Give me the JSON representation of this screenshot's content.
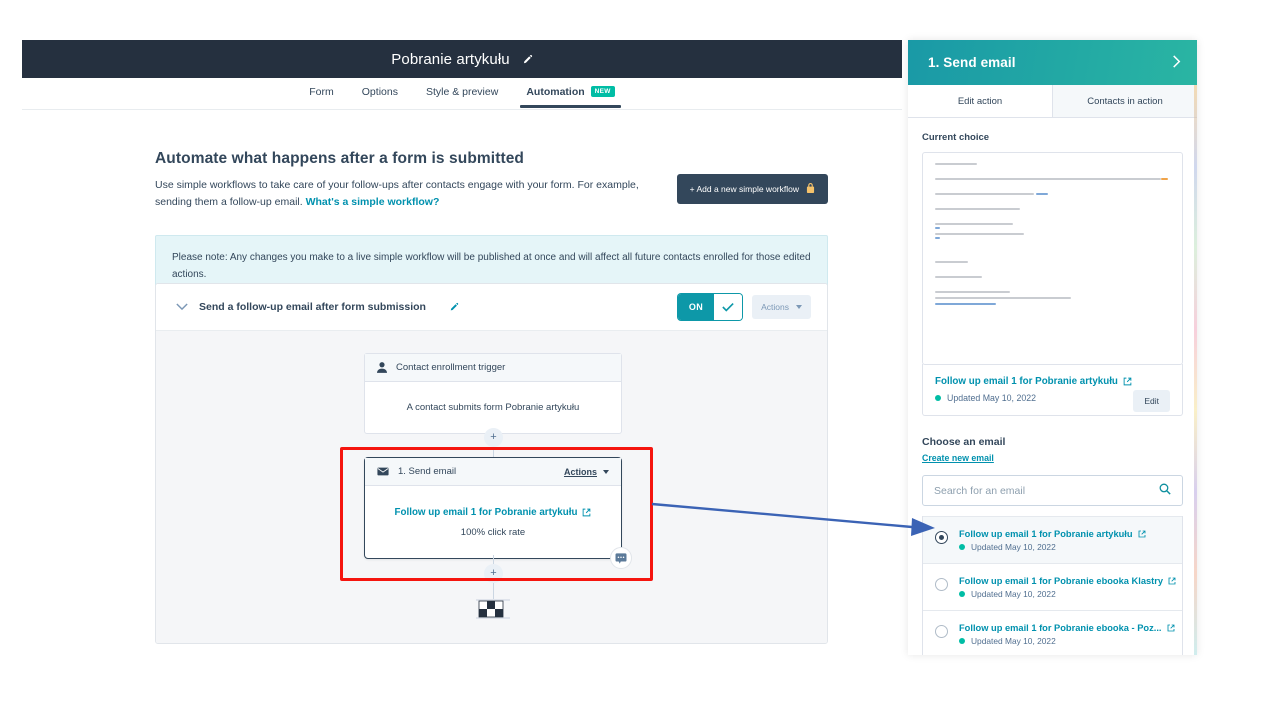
{
  "topbar": {
    "title": "Pobranie artykułu",
    "edit_icon": "pencil-icon"
  },
  "tabs": [
    {
      "label": "Form",
      "active": false
    },
    {
      "label": "Options",
      "active": false
    },
    {
      "label": "Style & preview",
      "active": false
    },
    {
      "label": "Automation",
      "active": true,
      "badge": "NEW"
    }
  ],
  "main": {
    "heading": "Automate what happens after a form is submitted",
    "sub_line1": "Use simple workflows to take care of your follow-ups after contacts engage with your form. For example,",
    "sub_line2": "sending them a follow-up email.",
    "sub_link": "What's a simple workflow?",
    "add_workflow_button": "+ Add a new simple workflow",
    "lock_icon": "lock-icon",
    "note": "Please note: Any changes you make to a live simple workflow will be published at once and will affect all future contacts enrolled for those edited actions."
  },
  "workflow": {
    "title": "Send a follow-up email after form submission",
    "chevron_icon": "chevron-down-icon",
    "edit_icon": "pencil-icon",
    "toggle_label": "ON",
    "toggle_check": "✓",
    "actions_label": "Actions",
    "caret_icon": "chevron-down-icon"
  },
  "flow": {
    "trigger": {
      "header": "Contact enrollment trigger",
      "header_icon": "person-icon",
      "body": "A contact submits form Pobranie artykułu"
    },
    "email_step": {
      "header": "1. Send email",
      "header_icon": "envelope-icon",
      "actions_label": "Actions",
      "email_name": "Follow up email 1 for Pobranie artykułu",
      "external_icon": "external-link-icon",
      "click_rate": "100% click rate",
      "comment_icon": "comment-icon"
    },
    "plus_icon": "plus-icon",
    "end_icon": "checkered-flag-icon"
  },
  "annotations": {
    "red_box": "#f5150f",
    "blue_arrow": "#3b63b5"
  },
  "panel": {
    "title": "1. Send email",
    "close_icon": "close-icon",
    "tabs": [
      {
        "label": "Edit action",
        "active": true
      },
      {
        "label": "Contacts in action",
        "active": false
      }
    ],
    "current_choice_label": "Current choice",
    "preview_icon": "email-preview-thumbnail",
    "current_email": {
      "name": "Follow up email 1 for Pobranie artykułu",
      "external_icon": "external-link-icon",
      "status_dot": "#00bda5",
      "updated": "Updated May 10, 2022",
      "edit_button": "Edit"
    },
    "choose_heading": "Choose an email",
    "create_new_link": "Create new email",
    "search": {
      "placeholder": "Search for an email",
      "value": "",
      "icon": "search-icon"
    },
    "email_options": [
      {
        "name": "Follow up email 1 for Pobranie artykułu",
        "updated": "Updated May 10, 2022",
        "selected": true,
        "external_icon": "external-link-icon"
      },
      {
        "name": "Follow up email 1 for Pobranie ebooka Klastry",
        "updated": "Updated May 10, 2022",
        "selected": false,
        "external_icon": "external-link-icon"
      },
      {
        "name": "Follow up email 1 for Pobranie ebooka - Poz...",
        "updated": "Updated May 10, 2022",
        "selected": false,
        "external_icon": "external-link-icon"
      }
    ]
  },
  "colors": {
    "teal": "#0d98a8",
    "navy": "#33475b",
    "link": "#0091ae",
    "green": "#00bda5",
    "canvas": "#f5f6f8"
  }
}
